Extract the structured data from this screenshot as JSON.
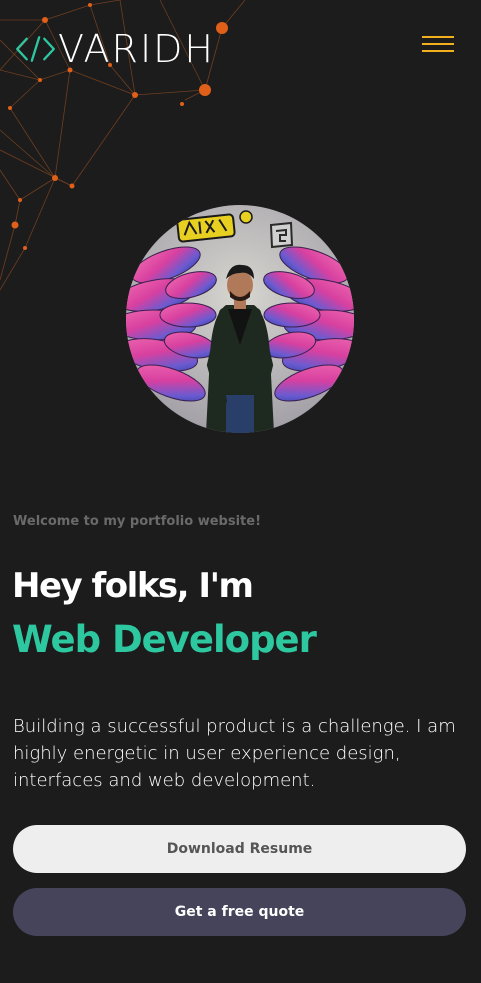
{
  "header": {
    "logo_text": "VARIDH",
    "menu_icon": "hamburger-menu-icon"
  },
  "profile": {
    "avatar_alt": "profile photo"
  },
  "hero": {
    "welcome": "Welcome to my portfolio website!",
    "greeting": "Hey folks, I'm",
    "role": "Web Developer",
    "description": "Building a successful product is a challenge. I am highly energetic in user experience design, interfaces and web development."
  },
  "actions": {
    "resume_label": "Download Resume",
    "quote_label": "Get a free quote"
  },
  "colors": {
    "background": "#1c1c1c",
    "accent_green": "#2ec8a0",
    "menu_yellow": "#f2b01e",
    "network_orange": "#e0601a",
    "quote_button": "#46445a"
  }
}
